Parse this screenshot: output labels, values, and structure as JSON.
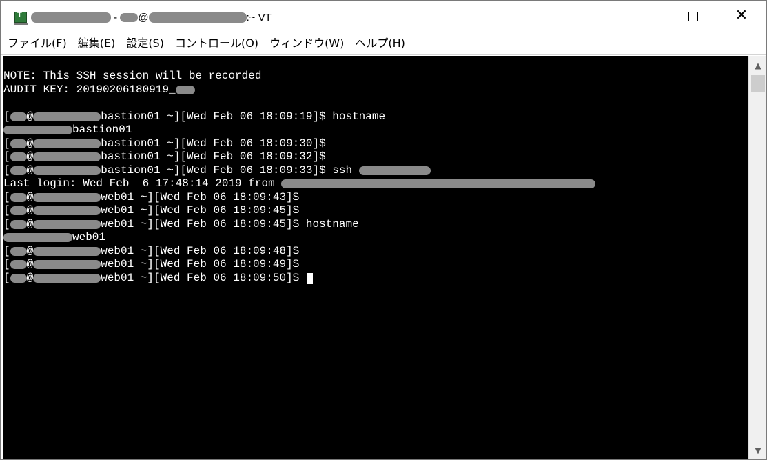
{
  "window": {
    "title_sep1": " - ",
    "title_at": "@",
    "title_suffix": ":~ VT",
    "minimize_glyph": "",
    "close_glyph": "✕"
  },
  "menu": {
    "items": [
      "ファイル(F)",
      "編集(E)",
      "設定(S)",
      "コントロール(O)",
      "ウィンドウ(W)",
      "ヘルプ(H)"
    ]
  },
  "terminal": {
    "note": "NOTE: This SSH session will be recorded",
    "audit_prefix": "AUDIT KEY: 20190206180919_",
    "l1_host": "bastion01 ~][Wed Feb 06 18:09:19]$ hostname",
    "l2": "bastion01",
    "l3_host": "bastion01 ~][Wed Feb 06 18:09:30]$",
    "l4_host": "bastion01 ~][Wed Feb 06 18:09:32]$",
    "l5_host": "bastion01 ~][Wed Feb 06 18:09:33]$ ssh ",
    "last_login": "Last login: Wed Feb  6 17:48:14 2019 from ",
    "l7_host": "web01 ~][Wed Feb 06 18:09:43]$",
    "l8_host": "web01 ~][Wed Feb 06 18:09:45]$",
    "l9_host": "web01 ~][Wed Feb 06 18:09:45]$ hostname",
    "l10": "web01",
    "l11_host": "web01 ~][Wed Feb 06 18:09:48]$",
    "l12_host": "web01 ~][Wed Feb 06 18:09:49]$",
    "l13_host": "web01 ~][Wed Feb 06 18:09:50]$ ",
    "bracket": "[",
    "at": "@"
  },
  "scrollbar": {
    "up_glyph": "▲",
    "down_glyph": "▼"
  }
}
